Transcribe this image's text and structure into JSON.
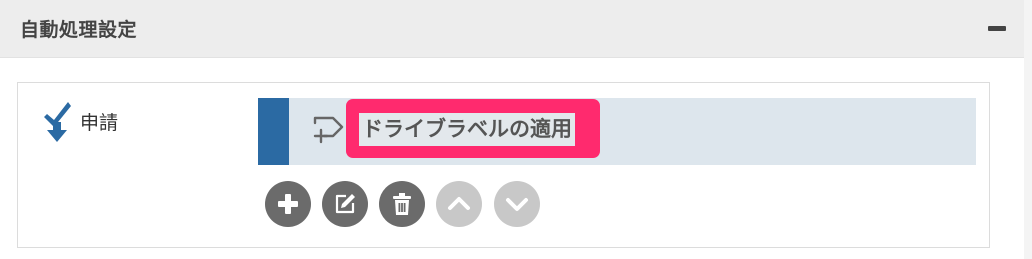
{
  "panel": {
    "title": "自動処理設定",
    "collapse_icon": "minus-icon"
  },
  "item": {
    "label": "申請",
    "icon": "check-down-arrow-icon"
  },
  "action": {
    "label": "ドライブラベルの適用",
    "icon": "flow-add-icon",
    "accent_color": "#2b6aa3",
    "highlight_color": "#ff2a6e"
  },
  "toolbar": {
    "buttons": [
      {
        "icon": "plus-icon",
        "enabled": true
      },
      {
        "icon": "edit-icon",
        "enabled": true
      },
      {
        "icon": "trash-icon",
        "enabled": true
      },
      {
        "icon": "chevron-up-icon",
        "enabled": false
      },
      {
        "icon": "chevron-down-icon",
        "enabled": false
      }
    ]
  }
}
